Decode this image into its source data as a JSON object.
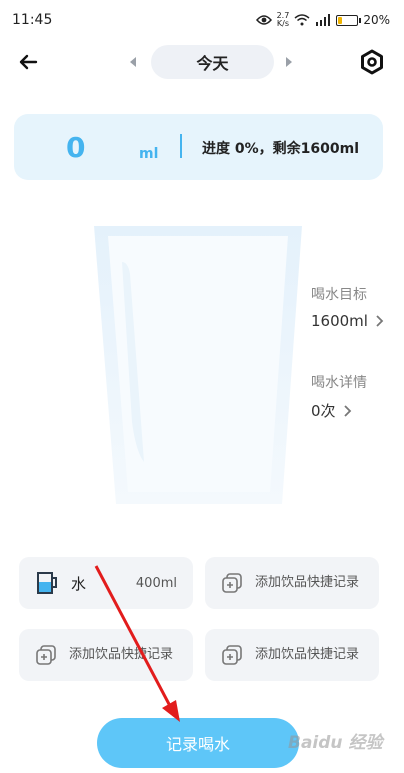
{
  "status_bar": {
    "time": "11:45",
    "net_speed_top": "2.7",
    "net_speed_unit": "K/s",
    "battery": "20%",
    "battery_level": 0.2,
    "icons": [
      "eye-icon",
      "wifi-icon",
      "signal-icon",
      "battery-icon"
    ]
  },
  "header": {
    "date_label": "今天",
    "icons": [
      "back-arrow-icon",
      "prev-day-icon",
      "next-day-icon",
      "settings-icon"
    ]
  },
  "progress": {
    "amount": "0",
    "unit": "ml",
    "summary": "进度 0%，剩余1600ml",
    "percent": 0,
    "accent_color": "#45b4ef",
    "card_color": "#e6f4fc"
  },
  "side_panel": {
    "goal_label": "喝水目标",
    "goal_value": "1600ml",
    "detail_label": "喝水详情",
    "detail_value": "0次"
  },
  "shortcuts": [
    {
      "name": "水",
      "amount": "400ml",
      "icon": "cup-icon"
    },
    {
      "label": "添加饮品快捷记录",
      "icon": "add-drink-icon"
    },
    {
      "label": "添加饮品快捷记录",
      "icon": "add-drink-icon"
    },
    {
      "label": "添加饮品快捷记录",
      "icon": "add-drink-icon"
    }
  ],
  "record_button": {
    "label": "记录喝水",
    "color": "#5ec6f8"
  },
  "watermark": "Baidu 经验"
}
